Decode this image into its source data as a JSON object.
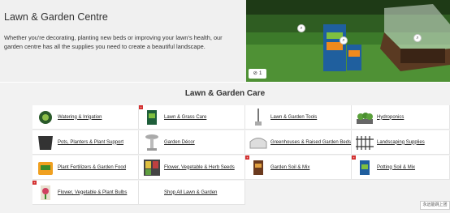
{
  "hero": {
    "title": "Lawn & Garden Centre",
    "description": "Whether you're decorating, planting new beds or improving your lawn's health, our garden centre has all the supplies you need to create a beautiful landscape.",
    "like_count": "1"
  },
  "section": {
    "title": "Lawn & Garden Care"
  },
  "categories": [
    {
      "label": "Watering & Irrigation",
      "icon": "hose-reel-icon"
    },
    {
      "label": "Lawn & Grass Care",
      "icon": "lawn-product-icon"
    },
    {
      "label": "Lawn & Garden Tools",
      "icon": "garden-tool-icon"
    },
    {
      "label": "Hydroponics",
      "icon": "plant-tray-icon"
    },
    {
      "label": "Pots, Planters & Plant Support",
      "icon": "planter-icon"
    },
    {
      "label": "Garden Décor",
      "icon": "birdbath-icon"
    },
    {
      "label": "Greenhouses & Raised Garden Beds",
      "icon": "greenhouse-icon"
    },
    {
      "label": "Landscaping Supplies",
      "icon": "fence-icon"
    },
    {
      "label": "Plant Fertilizers & Garden Food",
      "icon": "fertilizer-icon"
    },
    {
      "label": "Flower, Vegetable & Herb Seeds",
      "icon": "seed-packets-icon"
    },
    {
      "label": "Garden Soil & Mix",
      "icon": "soil-bag-icon"
    },
    {
      "label": "Potting Soil & Mix",
      "icon": "potting-soil-icon"
    },
    {
      "label": "Flower, Vegetable & Plant Bulbs",
      "icon": "bulbs-icon"
    },
    {
      "label": "Shop All Lawn & Garden",
      "icon": ""
    }
  ],
  "help_button": "永远能跳上团",
  "colors": {
    "accent_red": "#d32f2f",
    "grass": "#3d7a2c"
  }
}
